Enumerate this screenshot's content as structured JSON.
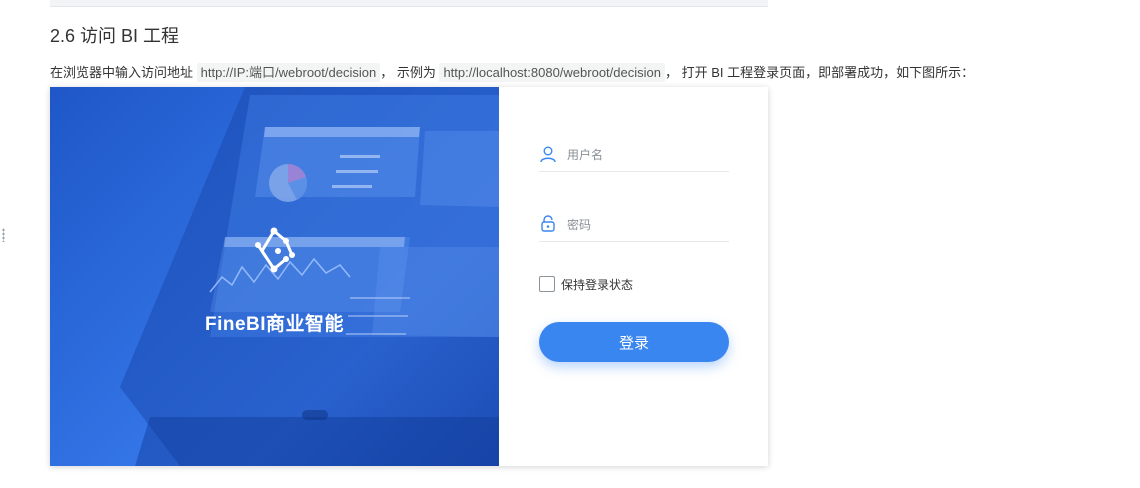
{
  "section": {
    "heading": "2.6 访问 BI 工程",
    "intro": {
      "prefix": "在浏览器中输入访问地址 ",
      "address_code": "http://IP:端口/webroot/decision",
      "middle": "， 示例为 ",
      "example_code": "http://localhost:8080/webroot/decision",
      "suffix": "， 打开 BI 工程登录页面，即部署成功，如下图所示："
    }
  },
  "figure": {
    "brand": {
      "name": "FineBI商业智能"
    },
    "login": {
      "username_placeholder": "用户名",
      "password_placeholder": "密码",
      "remember_label": "保持登录状态",
      "remember_checked": false,
      "submit_label": "登录"
    }
  },
  "colors": {
    "accent": "#3a86f0",
    "hero_blue": "#2f6fe0"
  },
  "icons": {
    "username": "user-icon",
    "password": "lock-icon",
    "brand": "finebi-logo-icon"
  }
}
